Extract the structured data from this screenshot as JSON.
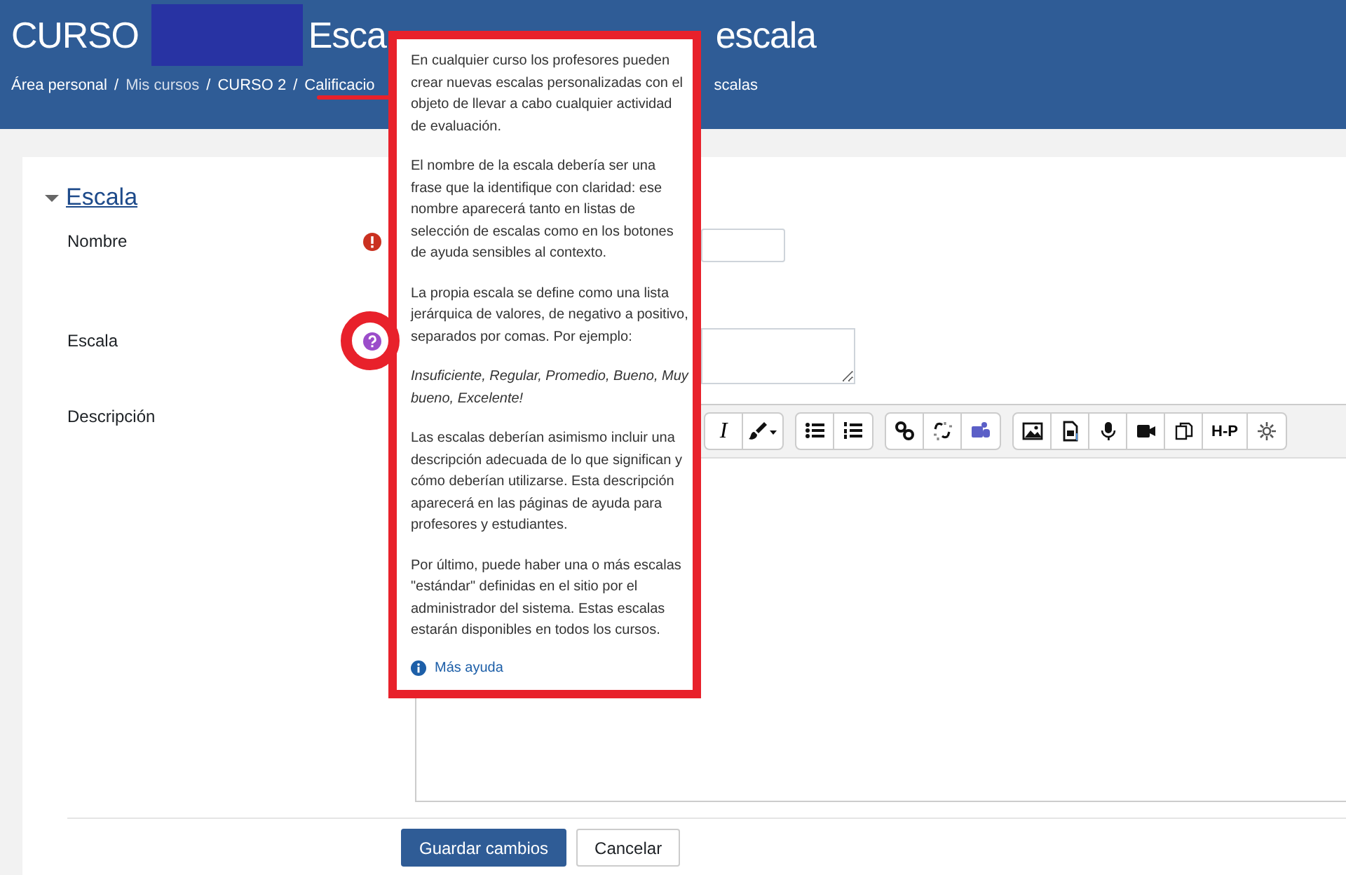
{
  "header": {
    "title_parts": [
      "CURSO",
      "Esca",
      "escala"
    ],
    "separator": "/",
    "breadcrumb": [
      {
        "label": "Área personal",
        "muted": false
      },
      {
        "label": "Mis cursos",
        "muted": true
      },
      {
        "label": "CURSO 2",
        "muted": false
      },
      {
        "label": "Calificacio",
        "muted": false
      },
      {
        "label": "scalas",
        "muted": false
      }
    ]
  },
  "section": {
    "title": "Escala",
    "expanded": true
  },
  "fields": [
    {
      "label": "Nombre",
      "kind": "text",
      "required": true,
      "help": false
    },
    {
      "label": "Escala",
      "kind": "textarea",
      "required": false,
      "help": true
    },
    {
      "label": "Descripción",
      "kind": "editor",
      "required": false,
      "help": false
    }
  ],
  "toolbar": [
    [
      {
        "kind": "italic",
        "label": "I"
      },
      {
        "kind": "brush"
      }
    ],
    [
      {
        "kind": "bullets"
      },
      {
        "kind": "numbers"
      }
    ],
    [
      {
        "kind": "link"
      },
      {
        "kind": "unlink"
      },
      {
        "kind": "teams"
      }
    ],
    [
      {
        "kind": "image"
      },
      {
        "kind": "file"
      },
      {
        "kind": "mic"
      },
      {
        "kind": "video"
      },
      {
        "kind": "copy"
      },
      {
        "kind": "h5p",
        "label": "H-P"
      },
      {
        "kind": "gear"
      }
    ]
  ],
  "buttons": [
    {
      "label": "Guardar cambios",
      "kind": "primary"
    },
    {
      "label": "Cancelar",
      "kind": "secondary"
    }
  ],
  "help_popup": {
    "paragraphs": [
      {
        "kind": "text",
        "text": "En cualquier curso los profesores pueden crear nuevas escalas personalizadas con el objeto de llevar a cabo cualquier actividad de evaluación."
      },
      {
        "kind": "text",
        "text": "El nombre de la escala debería ser una frase que la identifique con claridad: ese nombre aparecerá tanto en listas de selección de escalas como en los botones de ayuda sensibles al contexto."
      },
      {
        "kind": "text",
        "text": "La propia escala se define como una lista jerárquica de valores, de negativo a positivo, separados por comas. Por ejemplo:"
      },
      {
        "kind": "example",
        "text": "Insuficiente, Regular, Promedio, Bueno, Muy bueno, Excelente!"
      },
      {
        "kind": "text",
        "text": "Las escalas deberían asimismo incluir una descripción adecuada de lo que significan y cómo deberían utilizarse. Esta descripción aparecerá en las páginas de ayuda para profesores y estudiantes."
      },
      {
        "kind": "text",
        "text": "Por último, puede haber una o más escalas \"estándar\" definidas en el sitio por el administrador del sistema. Estas escalas estarán disponibles en todos los cursos."
      }
    ],
    "link": "Más ayuda"
  }
}
